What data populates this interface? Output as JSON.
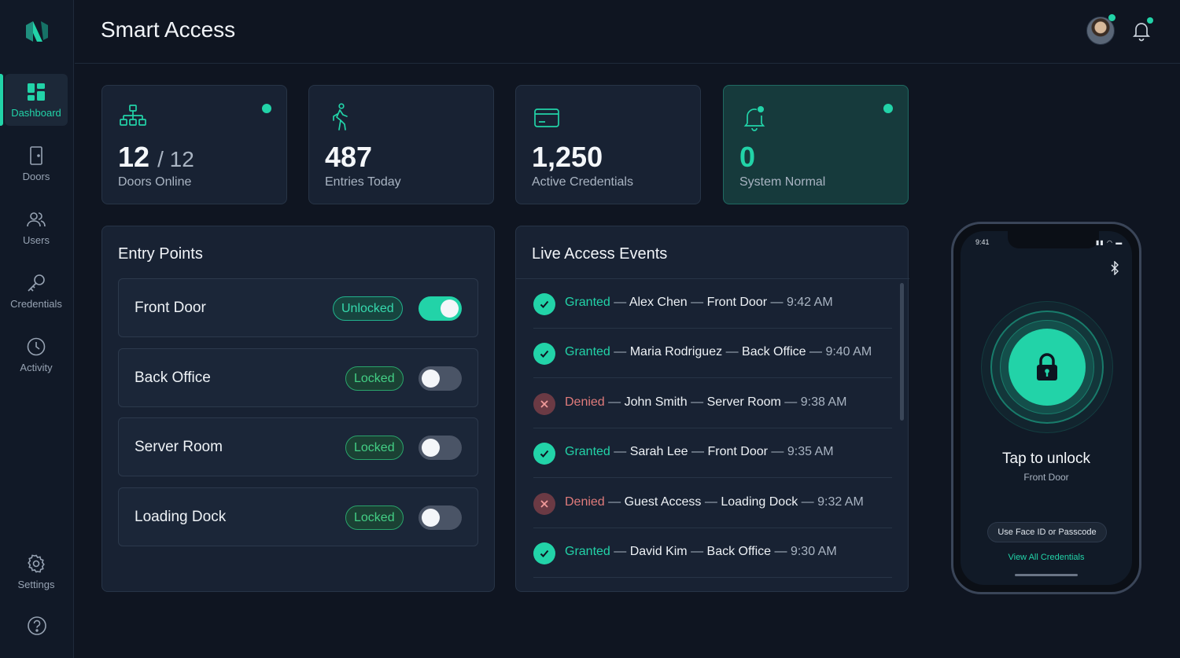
{
  "app": {
    "title": "Smart Access"
  },
  "colors": {
    "accent": "#22d3a8",
    "background": "#0f1521",
    "card": "#182233",
    "denied": "#e07b7b"
  },
  "sidebar": {
    "items": [
      {
        "label": "Dashboard",
        "icon": "dashboard-icon",
        "active": true
      },
      {
        "label": "Doors",
        "icon": "door-icon"
      },
      {
        "label": "Users",
        "icon": "users-icon"
      },
      {
        "label": "Credentials",
        "icon": "key-icon"
      },
      {
        "label": "Activity",
        "icon": "clock-icon"
      },
      {
        "label": "Settings",
        "icon": "gear-icon"
      }
    ]
  },
  "stats": [
    {
      "value": "12",
      "sub": "/ 12",
      "label": "Doors Online",
      "icon": "network-icon"
    },
    {
      "value": "487",
      "label": "Entries Today",
      "icon": "walking-person-icon"
    },
    {
      "value": "1,250",
      "label": "Active Credentials",
      "icon": "credit-card-icon"
    },
    {
      "value": "0",
      "label": "System Normal",
      "icon": "bell-alert-icon"
    }
  ],
  "entry_points": {
    "title": "Entry Points",
    "doors": [
      {
        "name": "Front Door",
        "status": "Unlocked",
        "on": true
      },
      {
        "name": "Back Office",
        "status": "Locked",
        "on": false
      },
      {
        "name": "Server Room",
        "status": "Locked",
        "on": false
      },
      {
        "name": "Loading Dock",
        "status": "Locked",
        "on": false
      }
    ]
  },
  "events": {
    "title": "Live Access Events",
    "sep": "—",
    "items": [
      {
        "status": "Granted",
        "user": "Alex Chen",
        "door": "Front Door",
        "time": "9:42 AM"
      },
      {
        "status": "Granted",
        "user": "Maria Rodriguez",
        "door": "Back Office",
        "time": "9:40 AM"
      },
      {
        "status": "Denied",
        "user": "John Smith",
        "door": "Server Room",
        "time": "9:38 AM"
      },
      {
        "status": "Granted",
        "user": "Sarah Lee",
        "door": "Front Door",
        "time": "9:35 AM"
      },
      {
        "status": "Denied",
        "user": "Guest Access",
        "door": "Loading Dock",
        "time": "9:32 AM"
      },
      {
        "status": "Granted",
        "user": "David Kim",
        "door": "Back Office",
        "time": "9:30 AM"
      }
    ]
  },
  "phone": {
    "time": "9:41",
    "tap_title": "Tap to unlock",
    "door": "Front Door",
    "faceid_label": "Use Face ID or Passcode",
    "view_link": "View All Credentials"
  }
}
